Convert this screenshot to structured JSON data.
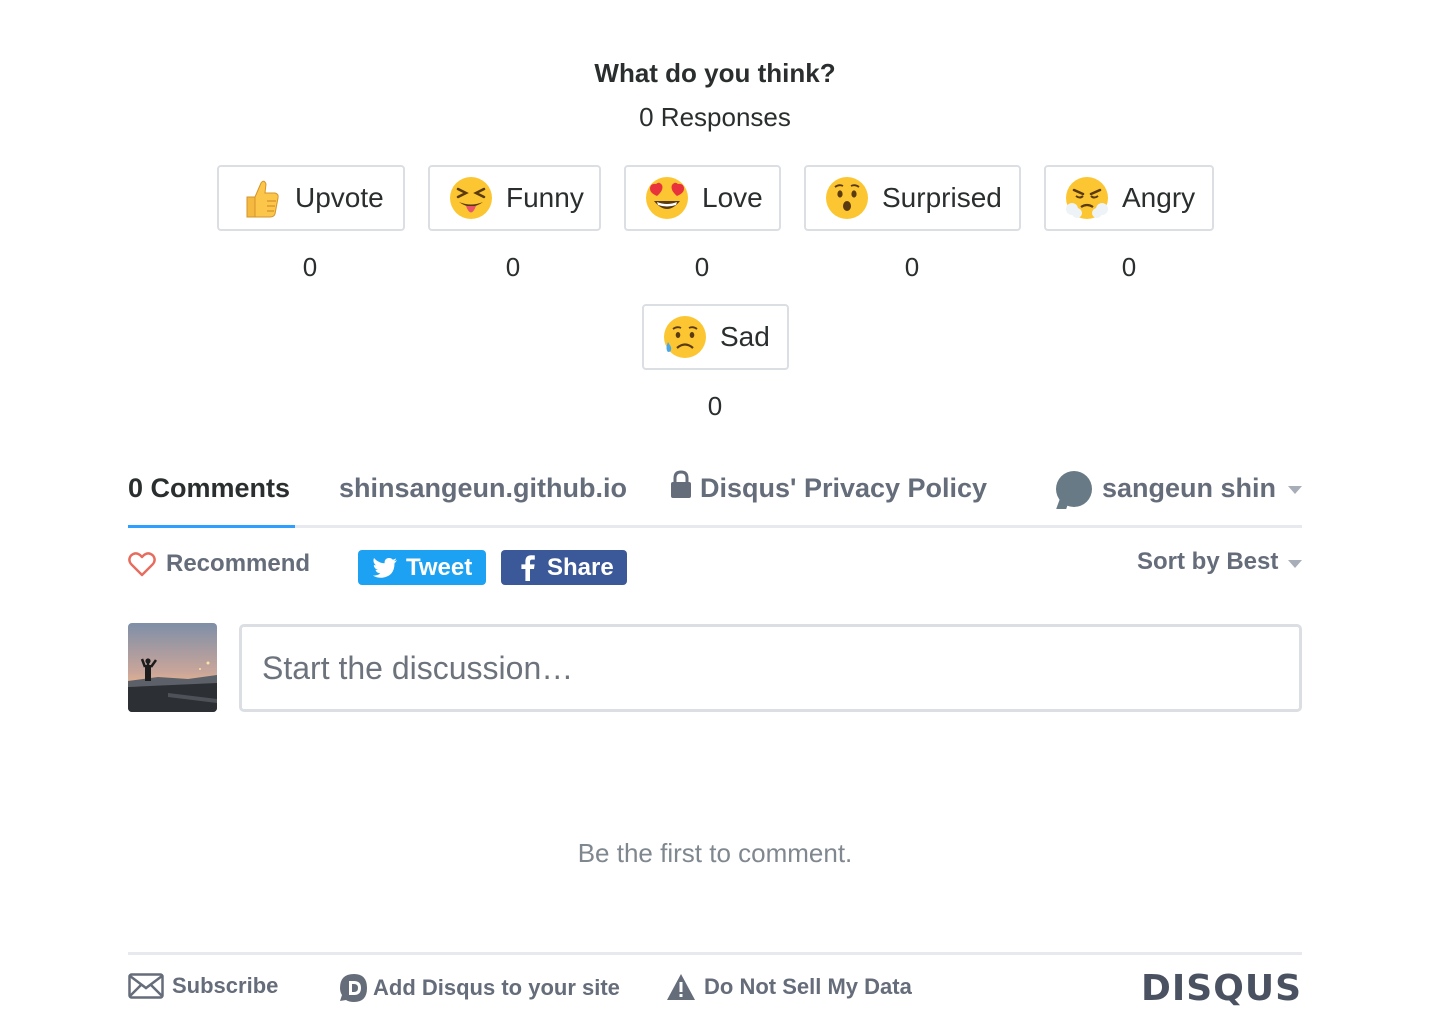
{
  "reactions_panel": {
    "title": "What do you think?",
    "responses": "0 Responses",
    "reactions": [
      {
        "label": "Upvote",
        "count": "0",
        "icon": "thumbs-up-emoji"
      },
      {
        "label": "Funny",
        "count": "0",
        "icon": "squinting-tongue-emoji"
      },
      {
        "label": "Love",
        "count": "0",
        "icon": "heart-eyes-emoji"
      },
      {
        "label": "Surprised",
        "count": "0",
        "icon": "hushed-face-emoji"
      },
      {
        "label": "Angry",
        "count": "0",
        "icon": "steam-face-emoji"
      },
      {
        "label": "Sad",
        "count": "0",
        "icon": "sad-sweat-face-emoji"
      }
    ]
  },
  "nav": {
    "comments_tab": "0 Comments",
    "site_link": "shinsangeun.github.io",
    "privacy_link": "Disqus' Privacy Policy",
    "user_name": "sangeun shin"
  },
  "actions": {
    "recommend": "Recommend",
    "tweet": "Tweet",
    "share": "Share",
    "sort": "Sort by Best"
  },
  "composer": {
    "placeholder": "Start the discussion…",
    "value": ""
  },
  "empty_state": "Be the first to comment.",
  "footer": {
    "subscribe": "Subscribe",
    "add_disqus": "Add Disqus to your site",
    "do_not_sell": "Do Not Sell My Data",
    "brand": "DISQUS"
  },
  "colors": {
    "twitter": "#1da1f2",
    "facebook": "#3b5998",
    "accent": "#2e9fff",
    "recommend_heart": "#e76c5e"
  }
}
